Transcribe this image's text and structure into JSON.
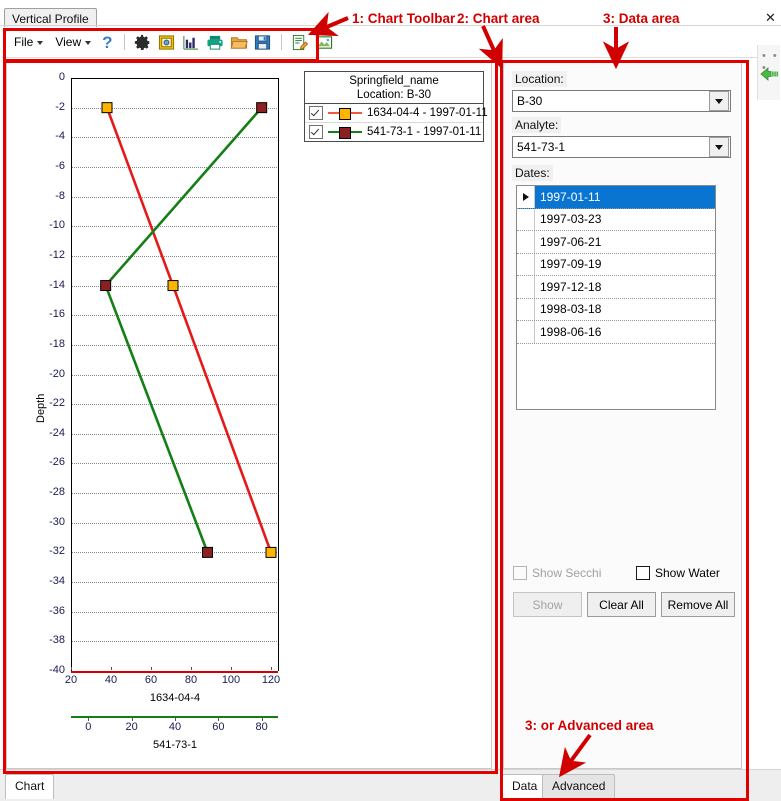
{
  "window": {
    "document_tab": "Vertical Profile",
    "close_label": "✕",
    "edge_dots": "• • •"
  },
  "toolbar": {
    "menus": [
      {
        "label": "File"
      },
      {
        "label": "View"
      }
    ],
    "help_glyph": "?",
    "icons": [
      {
        "name": "gear-icon",
        "title": "Settings"
      },
      {
        "name": "chart-properties-icon",
        "title": "Chart Properties"
      },
      {
        "name": "bar-chart-icon",
        "title": "Chart Type"
      },
      {
        "name": "printer-icon",
        "title": "Print"
      },
      {
        "name": "folder-open-icon",
        "title": "Open"
      },
      {
        "name": "save-icon",
        "title": "Save"
      },
      {
        "name": "edit-note-icon",
        "title": "Edit"
      },
      {
        "name": "export-image-icon",
        "title": "Export Image"
      }
    ]
  },
  "legend": {
    "title": "Springfield_name",
    "subtitle": "Location: B-30",
    "entries": [
      {
        "label": "1634-04-4 - 1997-01-11",
        "line_color": "#f05a3c",
        "marker_color": "#ffb400",
        "checked": true
      },
      {
        "label": "541-73-1 - 1997-01-11",
        "line_color": "#157f15",
        "marker_color": "#8a2020",
        "checked": true
      }
    ]
  },
  "chart_data": {
    "type": "line",
    "title": "Springfield_name",
    "subtitle": "Location: B-30",
    "orientation": "vertical-profile",
    "ylabel": "Depth",
    "ylim": [
      -40,
      0
    ],
    "yticks": [
      0,
      -2,
      -4,
      -6,
      -8,
      -10,
      -12,
      -14,
      -16,
      -18,
      -20,
      -22,
      -24,
      -26,
      -28,
      -30,
      -32,
      -34,
      -36,
      -38,
      -40
    ],
    "grid": true,
    "legend_position": "top-right-outside",
    "axes": [
      {
        "name": "1634-04-4",
        "color": "#d40000",
        "xlim": [
          20,
          124
        ],
        "xticks": [
          20,
          40,
          60,
          80,
          100,
          120
        ],
        "label": "1634-04-4"
      },
      {
        "name": "541-73-1",
        "color": "#157f15",
        "xlim": [
          -8,
          88
        ],
        "xticks": [
          0,
          20,
          40,
          60,
          80
        ],
        "label": "541-73-1"
      }
    ],
    "series": [
      {
        "name": "1634-04-4 - 1997-01-11",
        "axis": "1634-04-4",
        "line_color": "#e61919",
        "marker_color": "#ffb400",
        "marker": "square",
        "points": [
          {
            "x": 38,
            "y": -2
          },
          {
            "x": 71,
            "y": -14
          },
          {
            "x": 120,
            "y": -32
          }
        ]
      },
      {
        "name": "541-73-1 - 1997-01-11",
        "axis": "541-73-1",
        "line_color": "#157f15",
        "marker_color": "#8a2020",
        "marker": "square",
        "points": [
          {
            "x": 80,
            "y": -2
          },
          {
            "x": 8,
            "y": -14
          },
          {
            "x": 55,
            "y": -32
          }
        ]
      }
    ]
  },
  "data_panel": {
    "location_label": "Location:",
    "location_value": "B-30",
    "analyte_label": "Analyte:",
    "analyte_value": "541-73-1",
    "dates_label": "Dates:",
    "dates": [
      {
        "value": "1997-01-11",
        "selected": true
      },
      {
        "value": "1997-03-23",
        "selected": false
      },
      {
        "value": "1997-06-21",
        "selected": false
      },
      {
        "value": "1997-09-19",
        "selected": false
      },
      {
        "value": "1997-12-18",
        "selected": false
      },
      {
        "value": "1998-03-18",
        "selected": false
      },
      {
        "value": "1998-06-16",
        "selected": false
      }
    ],
    "show_secchi_label": "Show Secchi",
    "show_secchi_checked": false,
    "show_secchi_enabled": false,
    "show_water_label": "Show Water",
    "show_water_checked": false,
    "show_button": "Show",
    "show_button_enabled": false,
    "clear_all_button": "Clear All",
    "remove_all_button": "Remove All"
  },
  "bottom_tabs": {
    "left": [
      {
        "label": "Chart",
        "active": true
      }
    ],
    "right": [
      {
        "label": "Data",
        "active": true
      },
      {
        "label": "Advanced",
        "active": false
      }
    ]
  },
  "annotations": [
    {
      "id": "a1",
      "text": "1: Chart Toolbar"
    },
    {
      "id": "a2",
      "text": "2: Chart area"
    },
    {
      "id": "a3",
      "text": "3: Data area"
    },
    {
      "id": "a4",
      "text": "3: or Advanced area"
    }
  ],
  "colors": {
    "annotation_red": "#d00000",
    "highlight_red": "#e00000",
    "selection_blue": "#0a75d0",
    "series_red": "#e61919",
    "series_green": "#157f15",
    "marker_orange": "#ffb400",
    "marker_darkred": "#8a2020"
  }
}
